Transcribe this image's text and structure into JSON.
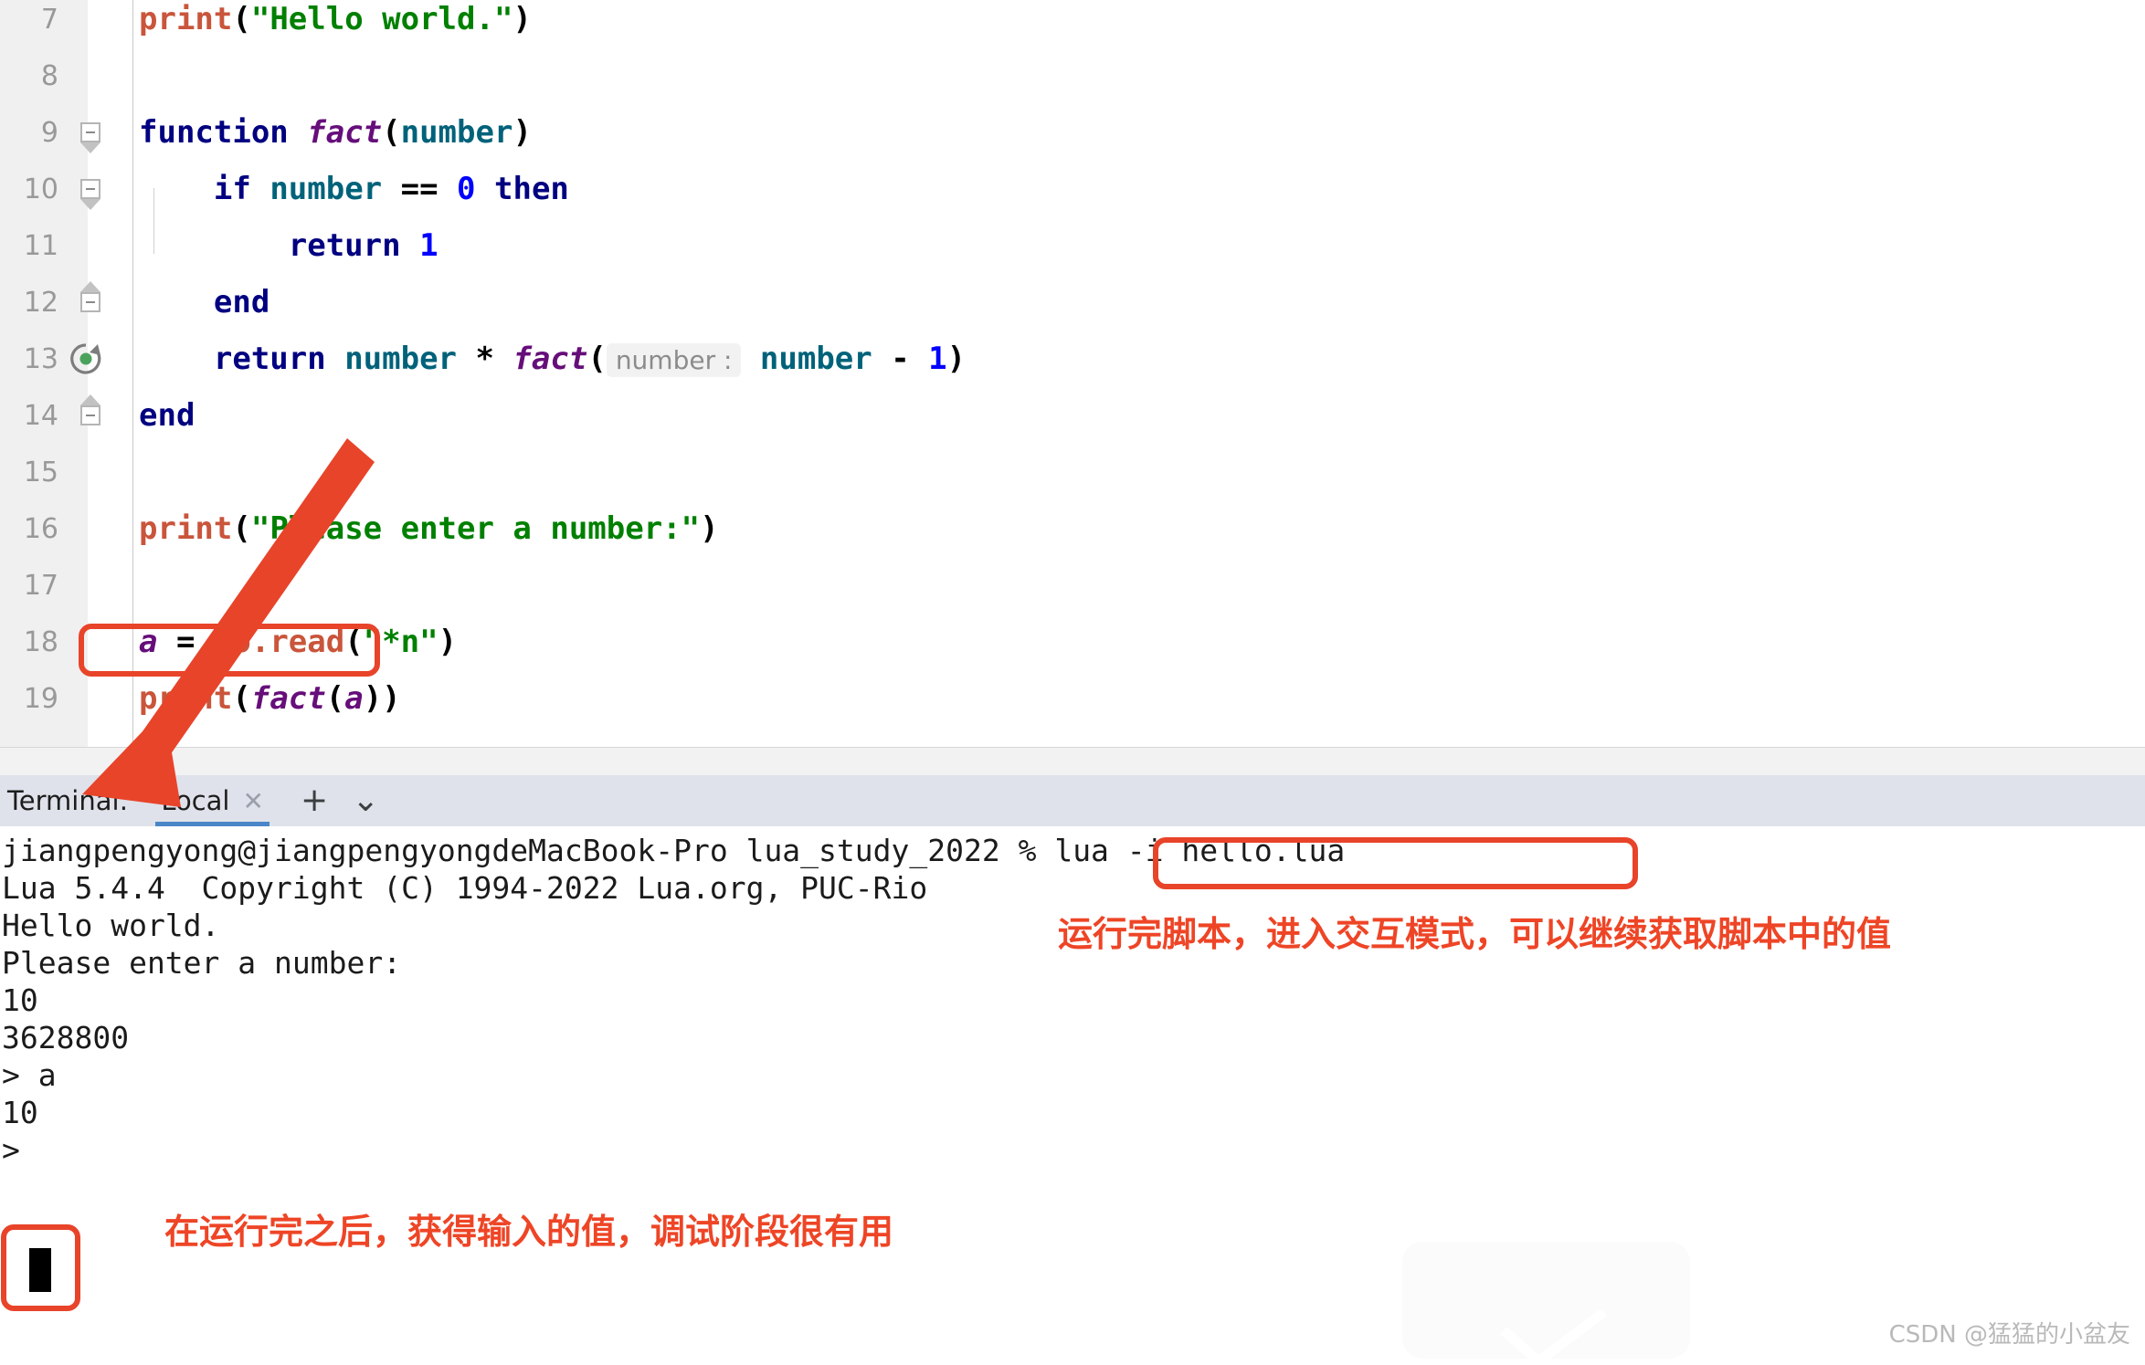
{
  "editor": {
    "name": "lua-code-editor",
    "lines": [
      {
        "no": "7",
        "fold": "none",
        "indent": 0,
        "segments": [
          {
            "cls": "t-fn",
            "text": "print"
          },
          {
            "cls": "t-plain",
            "text": "("
          },
          {
            "cls": "t-str",
            "text": "\"Hello world.\""
          },
          {
            "cls": "t-plain",
            "text": ")"
          }
        ]
      },
      {
        "no": "8",
        "fold": "none",
        "indent": 0,
        "segments": []
      },
      {
        "no": "9",
        "fold": "start",
        "indent": 0,
        "segments": [
          {
            "cls": "t-kw",
            "text": "function "
          },
          {
            "cls": "t-decl",
            "text": "fact"
          },
          {
            "cls": "t-plain",
            "text": "("
          },
          {
            "cls": "t-ident",
            "text": "number"
          },
          {
            "cls": "t-plain",
            "text": ")"
          }
        ]
      },
      {
        "no": "10",
        "fold": "start",
        "indent": 1,
        "segments": [
          {
            "cls": "t-plain",
            "text": "    "
          },
          {
            "cls": "t-kw",
            "text": "if "
          },
          {
            "cls": "t-ident",
            "text": "number"
          },
          {
            "cls": "t-plain",
            "text": " == "
          },
          {
            "cls": "t-num",
            "text": "0"
          },
          {
            "cls": "t-plain",
            "text": " "
          },
          {
            "cls": "t-kw",
            "text": "then"
          }
        ]
      },
      {
        "no": "11",
        "fold": "none",
        "indent": 2,
        "segments": [
          {
            "cls": "t-plain",
            "text": "        "
          },
          {
            "cls": "t-kw",
            "text": "return "
          },
          {
            "cls": "t-num",
            "text": "1"
          }
        ]
      },
      {
        "no": "12",
        "fold": "end",
        "indent": 1,
        "segments": [
          {
            "cls": "t-plain",
            "text": "    "
          },
          {
            "cls": "t-kw",
            "text": "end"
          }
        ]
      },
      {
        "no": "13",
        "fold": "none",
        "indent": 1,
        "icon": "recursion-icon",
        "segments": [
          {
            "cls": "t-plain",
            "text": "    "
          },
          {
            "cls": "t-kw",
            "text": "return "
          },
          {
            "cls": "t-ident",
            "text": "number"
          },
          {
            "cls": "t-plain",
            "text": " * "
          },
          {
            "cls": "t-decl",
            "text": "fact"
          },
          {
            "cls": "t-plain",
            "text": "("
          },
          {
            "cls": "t-hint",
            "text": "number :"
          },
          {
            "cls": "t-plain",
            "text": " "
          },
          {
            "cls": "t-ident",
            "text": "number"
          },
          {
            "cls": "t-plain",
            "text": " - "
          },
          {
            "cls": "t-num",
            "text": "1"
          },
          {
            "cls": "t-plain",
            "text": ")"
          }
        ]
      },
      {
        "no": "14",
        "fold": "end",
        "indent": 0,
        "segments": [
          {
            "cls": "t-kw",
            "text": "end"
          }
        ]
      },
      {
        "no": "15",
        "fold": "none",
        "indent": 0,
        "segments": []
      },
      {
        "no": "16",
        "fold": "none",
        "indent": 0,
        "segments": [
          {
            "cls": "t-fn",
            "text": "print"
          },
          {
            "cls": "t-plain",
            "text": "("
          },
          {
            "cls": "t-str",
            "text": "\"Please enter a number:\""
          },
          {
            "cls": "t-plain",
            "text": ")"
          }
        ]
      },
      {
        "no": "17",
        "fold": "none",
        "indent": 0,
        "segments": []
      },
      {
        "no": "18",
        "fold": "none",
        "indent": 0,
        "segments": [
          {
            "cls": "t-decl",
            "text": "a"
          },
          {
            "cls": "t-plain",
            "text": " = "
          },
          {
            "cls": "t-fn",
            "text": "io.read"
          },
          {
            "cls": "t-plain",
            "text": "("
          },
          {
            "cls": "t-str",
            "text": "\"*n\""
          },
          {
            "cls": "t-plain",
            "text": ")"
          }
        ]
      },
      {
        "no": "19",
        "fold": "none",
        "indent": 0,
        "segments": [
          {
            "cls": "t-fn",
            "text": "print"
          },
          {
            "cls": "t-plain",
            "text": "("
          },
          {
            "cls": "t-decl",
            "text": "fact"
          },
          {
            "cls": "t-plain",
            "text": "("
          },
          {
            "cls": "t-decl",
            "text": "a"
          },
          {
            "cls": "t-plain",
            "text": "))"
          }
        ]
      }
    ]
  },
  "terminal_toolbar": {
    "label": "Terminal:",
    "tab_label": "Local",
    "close_icon": "✕",
    "add_icon": "+",
    "chevron_icon": "⌄"
  },
  "terminal": {
    "lines": [
      "jiangpengyong@jiangpengyongdeMacBook-Pro lua_study_2022 % lua -i hello.lua",
      "Lua 5.4.4  Copyright (C) 1994-2022 Lua.org, PUC-Rio",
      "Hello world.",
      "Please enter a number:",
      "10",
      "3628800",
      "> a",
      "10",
      ">"
    ]
  },
  "annotations": {
    "box_line18_label": "a = io.read(\"*n\")",
    "box_command_label": "lua -i hello.lua",
    "box_result_label": "> a / 10",
    "note_top": "运行完脚本，进入交互模式，可以继续获取脚本中的值",
    "note_bottom": "在运行完之后，获得输入的值，调试阶段很有用",
    "accent_color": "#ee4526"
  },
  "watermark": {
    "text": "CSDN @猛猛的小盆友"
  }
}
